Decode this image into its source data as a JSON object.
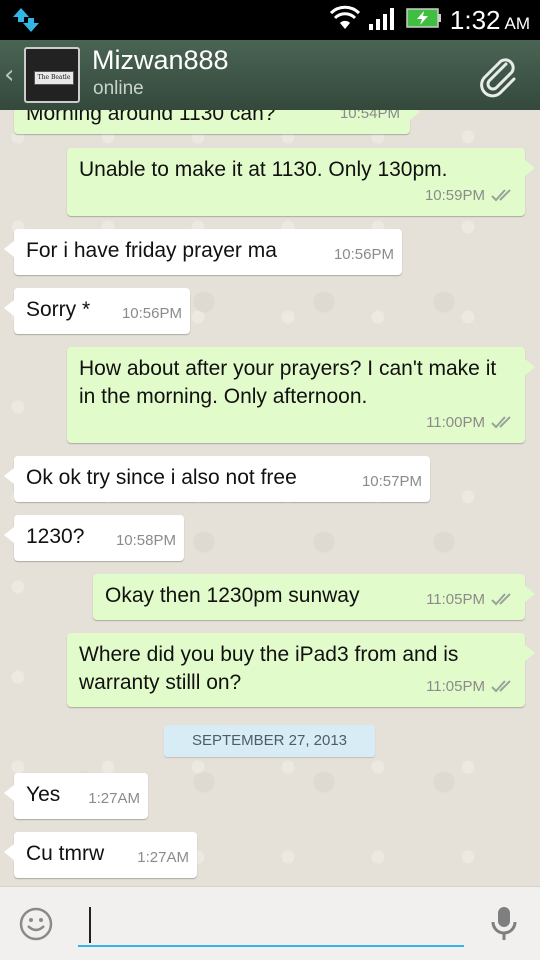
{
  "status_bar": {
    "time": "1:32",
    "ampm": "AM"
  },
  "header": {
    "contact_name": "Mizwan888",
    "contact_status": "online",
    "avatar_text": "The Beatle"
  },
  "messages": [
    {
      "dir": "out",
      "text": "Morning around 1130 can?",
      "time": "10:54PM"
    },
    {
      "dir": "out",
      "text": "Unable to make it at 1130. Only 130pm.",
      "time": "10:59PM"
    },
    {
      "dir": "in",
      "text": "For i have friday prayer ma",
      "time": "10:56PM"
    },
    {
      "dir": "in",
      "text": "Sorry *",
      "time": "10:56PM"
    },
    {
      "dir": "out",
      "text": "How about after your prayers? I can't make it in the morning. Only afternoon.",
      "time": "11:00PM"
    },
    {
      "dir": "in",
      "text": "Ok ok try since i also not free",
      "time": "10:57PM"
    },
    {
      "dir": "in",
      "text": "1230?",
      "time": "10:58PM"
    },
    {
      "dir": "out",
      "text": "Okay then 1230pm sunway",
      "time": "11:05PM"
    },
    {
      "dir": "out",
      "text": "Where did you buy the iPad3 from and is warranty stilll on?",
      "time": "11:05PM"
    },
    {
      "dir": "in",
      "text": "Yes",
      "time": "1:27AM"
    },
    {
      "dir": "in",
      "text": "Cu tmrw",
      "time": "1:27AM"
    }
  ],
  "date_separator": "SEPTEMBER 27, 2013",
  "input": {
    "value": "",
    "placeholder": ""
  },
  "colors": {
    "header_bg": "#3f5a4a",
    "outgoing_bubble": "#e2fbcb",
    "incoming_bubble": "#ffffff",
    "input_underline": "#33b5e5",
    "battery_green": "#3fbe3f"
  },
  "icons": {
    "status_left": "data-transfer-icon",
    "wifi": "wifi-icon",
    "signal": "signal-icon",
    "battery": "battery-charging-icon",
    "back": "back-chevron-icon",
    "attach": "paperclip-icon",
    "emoji": "smiley-icon",
    "mic": "microphone-icon"
  }
}
